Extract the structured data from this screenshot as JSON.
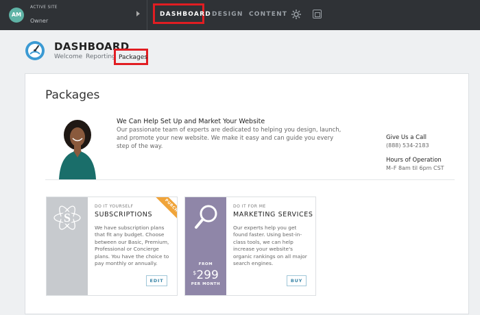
{
  "topbar": {
    "avatar_initials": "AM",
    "site_label": "ACTIVE SITE",
    "site_role": "Owner",
    "nav": {
      "dashboard": "DASHBOARD",
      "design": "DESIGN",
      "content": "CONTENT"
    },
    "icons": [
      "gear-icon",
      "calendar-icon"
    ]
  },
  "header": {
    "title": "DASHBOARD",
    "tabs": {
      "welcome": "Welcome",
      "reporting": "Reporting",
      "packages": "Packages"
    }
  },
  "main": {
    "title": "Packages",
    "promo": {
      "headline": "We Can Help Set Up and Market Your Website",
      "body": "Our passionate team of experts are dedicated to helping you design, launch, and promote your new website. We make it easy and can guide you every step of the way."
    },
    "contact": {
      "call_label": "Give Us a Call",
      "phone": "(888) 534-2183",
      "hours_label": "Hours of Operation",
      "hours": "M–F 8am til 6pm CST"
    },
    "packages": [
      {
        "kicker": "DO IT YOURSELF",
        "name": "SUBSCRIPTIONS",
        "description": "We have subscription plans that fit any budget. Choose between our Basic, Premium, Professional or Concierge plans. You have the choice to pay monthly or annually.",
        "badge": "PURCHASED",
        "button": "EDIT",
        "icon": "atom-s-icon"
      },
      {
        "kicker": "DO IT FOR ME",
        "name": "MARKETING SERVICES",
        "description": "Our experts help you get found faster. Using best-in-class tools, we can help increase your website's organic rankings on all major search engines.",
        "price_from": "FROM",
        "price_currency": "$",
        "price_amount": "299",
        "price_period": "PER MONTH",
        "button": "BUY",
        "icon": "magnifier-icon"
      }
    ]
  },
  "colors": {
    "topbar": "#2f3236",
    "highlight": "#e11d22",
    "avatar": "#5fb3a6",
    "badge": "#f0a43a",
    "marketing_side": "#8f86a8",
    "button": "#3a86a8"
  }
}
